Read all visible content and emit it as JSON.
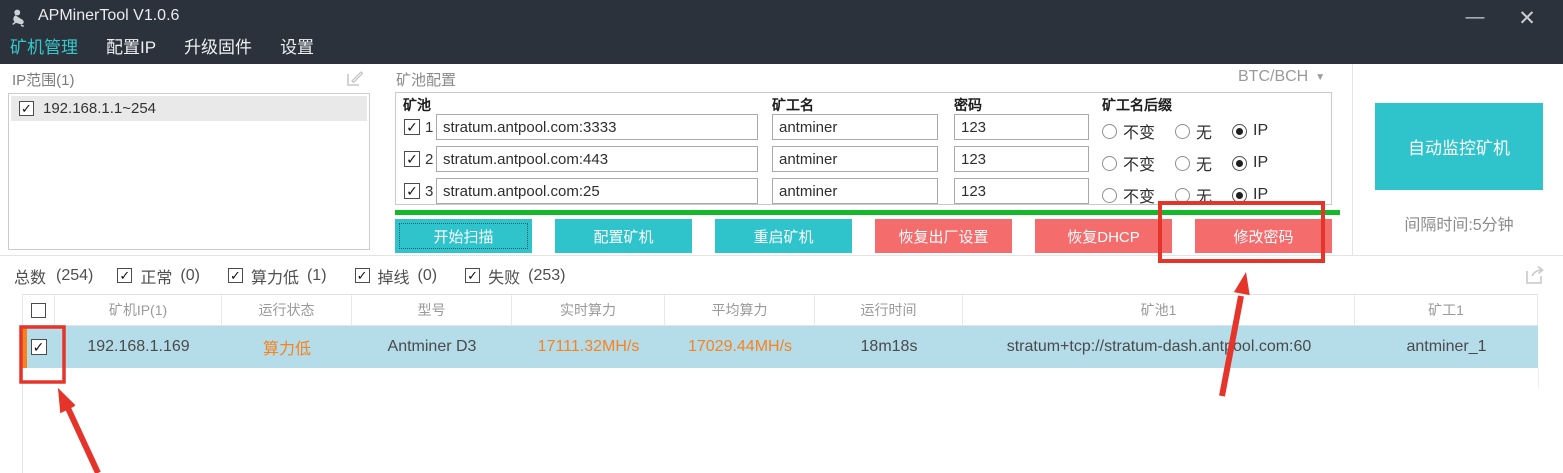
{
  "titlebar": {
    "title": "APMinerTool V1.0.6",
    "minimize": "—",
    "close": "✕"
  },
  "menu": {
    "items": [
      {
        "label": "矿机管理",
        "active": true
      },
      {
        "label": "配置IP",
        "active": false
      },
      {
        "label": "升级固件",
        "active": false
      },
      {
        "label": "设置",
        "active": false
      }
    ]
  },
  "ip_panel": {
    "label": "IP范围(1)",
    "items": [
      {
        "label": "192.168.1.1~254",
        "checked": true
      }
    ]
  },
  "pool_panel": {
    "title": "矿池配置",
    "coin_selector": "BTC/BCH",
    "col_pool": "矿池",
    "col_worker": "矿工名",
    "col_password": "密码",
    "col_suffix": "矿工名后缀",
    "suffix_opt_unchanged": "不变",
    "suffix_opt_none": "无",
    "suffix_opt_ip": "IP",
    "rows": [
      {
        "index": "1",
        "checked": true,
        "pool": "stratum.antpool.com:3333",
        "worker": "antminer",
        "password": "123",
        "suffix_selected": "IP"
      },
      {
        "index": "2",
        "checked": true,
        "pool": "stratum.antpool.com:443",
        "worker": "antminer",
        "password": "123",
        "suffix_selected": "IP"
      },
      {
        "index": "3",
        "checked": true,
        "pool": "stratum.antpool.com:25",
        "worker": "antminer",
        "password": "123",
        "suffix_selected": "IP"
      }
    ],
    "buttons": {
      "scan": "开始扫描",
      "configure": "配置矿机",
      "reboot": "重启矿机",
      "factory_reset": "恢复出厂设置",
      "restore_dhcp": "恢复DHCP",
      "change_password": "修改密码"
    }
  },
  "monitor_panel": {
    "button": "自动监控矿机",
    "interval": "间隔时间:5分钟"
  },
  "filter_bar": {
    "total_label": "总数",
    "total_count": "(254)",
    "filters": [
      {
        "label": "正常",
        "count": "(0)",
        "checked": true
      },
      {
        "label": "算力低",
        "count": "(1)",
        "checked": true
      },
      {
        "label": "掉线",
        "count": "(0)",
        "checked": true
      },
      {
        "label": "失败",
        "count": "(253)",
        "checked": true
      }
    ]
  },
  "table": {
    "headers": [
      "矿机IP(1)",
      "运行状态",
      "型号",
      "实时算力",
      "平均算力",
      "运行时间",
      "矿池1",
      "矿工1"
    ],
    "rows": [
      {
        "checked": true,
        "ip": "192.168.1.169",
        "status": "算力低",
        "model": "Antminer D3",
        "realtime_hashrate": "17111.32MH/s",
        "avg_hashrate": "17029.44MH/s",
        "uptime": "18m18s",
        "pool1": "stratum+tcp://stratum-dash.antpool.com:60",
        "worker1": "antminer_1"
      }
    ]
  },
  "colors": {
    "titlebar_bg": "#2c323b",
    "menu_active": "#35c8cb",
    "teal_button": "#2fc3cb",
    "red_button": "#f56c6c",
    "progress_green": "#14b929",
    "status_orange": "#f8821e",
    "row_highlight": "#b5dce9",
    "annotation_red": "#e5352b"
  }
}
